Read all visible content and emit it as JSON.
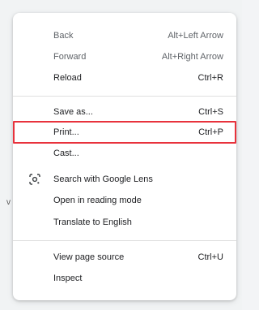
{
  "page": {
    "stub_text": "v"
  },
  "menu": {
    "items": [
      {
        "label": "Back",
        "shortcut": "Alt+Left Arrow"
      },
      {
        "label": "Forward",
        "shortcut": "Alt+Right Arrow"
      },
      {
        "label": "Reload",
        "shortcut": "Ctrl+R"
      },
      {
        "label": "Save as...",
        "shortcut": "Ctrl+S"
      },
      {
        "label": "Print...",
        "shortcut": "Ctrl+P"
      },
      {
        "label": "Cast...",
        "shortcut": ""
      },
      {
        "label": "Search with Google Lens",
        "shortcut": ""
      },
      {
        "label": "Open in reading mode",
        "shortcut": ""
      },
      {
        "label": "Translate to English",
        "shortcut": ""
      },
      {
        "label": "View page source",
        "shortcut": "Ctrl+U"
      },
      {
        "label": "Inspect",
        "shortcut": ""
      }
    ],
    "highlight_color": "#e8323c",
    "lens_icon": "google-lens-icon"
  }
}
